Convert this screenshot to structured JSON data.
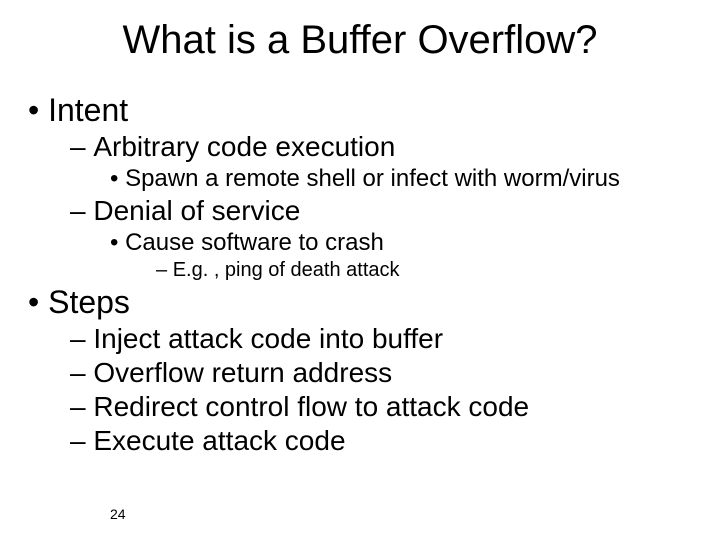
{
  "slide": {
    "title": "What is a Buffer Overflow?",
    "page_number": "24",
    "items": {
      "intent": {
        "label": "Intent",
        "arbcode": {
          "label": "Arbitrary code execution",
          "spawn": "Spawn a remote shell or infect with worm/virus"
        },
        "dos": {
          "label": "Denial of service",
          "crash": {
            "label": "Cause software to crash",
            "ping": "E.g. , ping of death attack"
          }
        }
      },
      "steps": {
        "label": "Steps",
        "s1": "Inject attack code into buffer",
        "s2": "Overflow return address",
        "s3": "Redirect control flow to attack code",
        "s4": "Execute attack code"
      }
    }
  }
}
